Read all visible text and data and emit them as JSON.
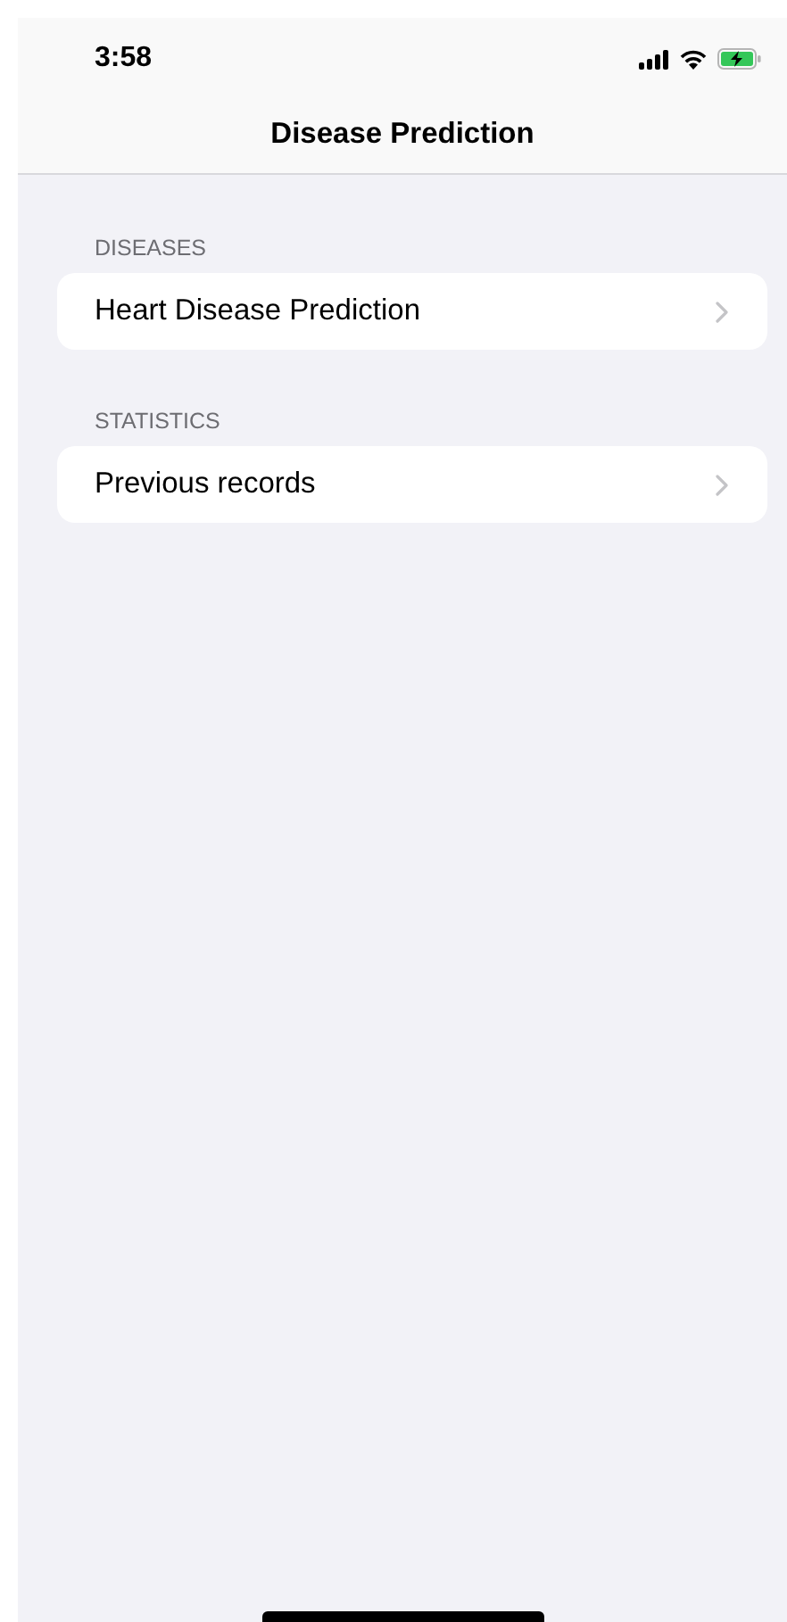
{
  "status_bar": {
    "time": "3:58"
  },
  "nav_bar": {
    "title": "Disease Prediction"
  },
  "sections": [
    {
      "header": "DISEASES",
      "items": [
        {
          "label": "Heart Disease Prediction"
        }
      ]
    },
    {
      "header": "STATISTICS",
      "items": [
        {
          "label": "Previous records"
        }
      ]
    }
  ]
}
